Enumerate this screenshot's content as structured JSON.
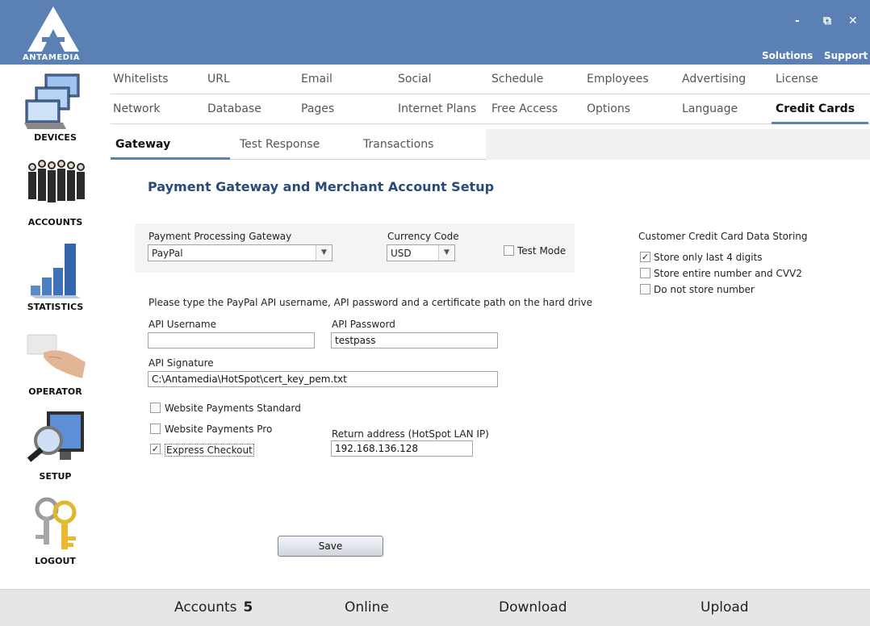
{
  "header": {
    "logo_text": "ANTAMEDIA",
    "minimize": "-",
    "restore": "⧉",
    "close": "✕",
    "solutions": "Solutions",
    "support": "Support"
  },
  "sidebar": {
    "items": [
      {
        "label": "DEVICES",
        "icon": "computers-icon"
      },
      {
        "label": "ACCOUNTS",
        "icon": "people-icon"
      },
      {
        "label": "STATISTICS",
        "icon": "bar-chart-icon"
      },
      {
        "label": "OPERATOR",
        "icon": "hand-card-icon"
      },
      {
        "label": "SETUP",
        "icon": "monitor-magnifier-icon"
      },
      {
        "label": "LOGOUT",
        "icon": "keys-icon"
      }
    ]
  },
  "menu": {
    "row1": [
      "Whitelists",
      "URL",
      "Email",
      "Social",
      "Schedule",
      "Employees",
      "Advertising",
      "License"
    ],
    "row2": [
      "Network",
      "Database",
      "Pages",
      "Internet Plans",
      "Free Access",
      "Options",
      "Language",
      "Credit Cards"
    ],
    "active": "Credit Cards"
  },
  "subtabs": {
    "items": [
      "Gateway",
      "Test Response",
      "Transactions"
    ],
    "active": "Gateway"
  },
  "form": {
    "title": "Payment Gateway and Merchant Account Setup",
    "gateway_label": "Payment Processing Gateway",
    "gateway_value": "PayPal",
    "currency_label": "Currency Code",
    "currency_value": "USD",
    "test_mode_label": "Test Mode",
    "test_mode_checked": false,
    "instructions": "Please type the PayPal API username, API password and a certificate path on the hard drive",
    "api_username_label": "API Username",
    "api_username_value": "",
    "api_password_label": "API Password",
    "api_password_value": "testpass",
    "api_signature_label": "API Signature",
    "api_signature_value": "C:\\Antamedia\\HotSpot\\cert_key_pem.txt",
    "wps_label": "Website Payments Standard",
    "wps_checked": false,
    "wpp_label": "Website Payments Pro",
    "wpp_checked": false,
    "express_label": "Express Checkout",
    "express_checked": true,
    "return_label": "Return address (HotSpot LAN IP)",
    "return_value": "192.168.136.128",
    "storing_title": "Customer Credit Card Data Storing",
    "store_last4_label": "Store only last 4 digits",
    "store_last4_checked": true,
    "store_entire_label": "Store entire number and CVV2",
    "store_entire_checked": false,
    "store_none_label": "Do not store number",
    "store_none_checked": false,
    "save_label": "Save"
  },
  "status": {
    "accounts_label": "Accounts",
    "accounts_value": "5",
    "online_label": "Online",
    "download_label": "Download",
    "upload_label": "Upload"
  },
  "colors": {
    "header_bg": "#5a80b4",
    "accent": "#5a80b4",
    "title": "#2a4a78"
  }
}
